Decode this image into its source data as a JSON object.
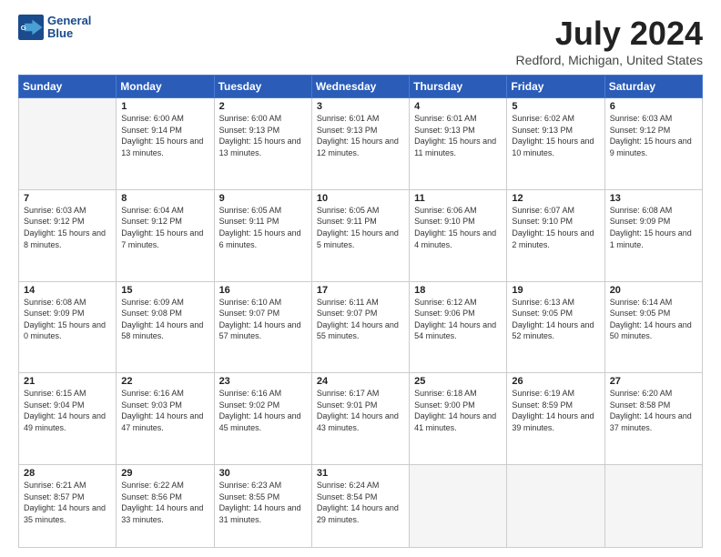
{
  "header": {
    "logo_line1": "General",
    "logo_line2": "Blue",
    "main_title": "July 2024",
    "subtitle": "Redford, Michigan, United States"
  },
  "calendar": {
    "days_of_week": [
      "Sunday",
      "Monday",
      "Tuesday",
      "Wednesday",
      "Thursday",
      "Friday",
      "Saturday"
    ],
    "weeks": [
      [
        {
          "day": "",
          "empty": true
        },
        {
          "day": "1",
          "sunrise": "6:00 AM",
          "sunset": "9:14 PM",
          "daylight": "15 hours and 13 minutes."
        },
        {
          "day": "2",
          "sunrise": "6:00 AM",
          "sunset": "9:13 PM",
          "daylight": "15 hours and 13 minutes."
        },
        {
          "day": "3",
          "sunrise": "6:01 AM",
          "sunset": "9:13 PM",
          "daylight": "15 hours and 12 minutes."
        },
        {
          "day": "4",
          "sunrise": "6:01 AM",
          "sunset": "9:13 PM",
          "daylight": "15 hours and 11 minutes."
        },
        {
          "day": "5",
          "sunrise": "6:02 AM",
          "sunset": "9:13 PM",
          "daylight": "15 hours and 10 minutes."
        },
        {
          "day": "6",
          "sunrise": "6:03 AM",
          "sunset": "9:12 PM",
          "daylight": "15 hours and 9 minutes."
        }
      ],
      [
        {
          "day": "7",
          "sunrise": "6:03 AM",
          "sunset": "9:12 PM",
          "daylight": "15 hours and 8 minutes."
        },
        {
          "day": "8",
          "sunrise": "6:04 AM",
          "sunset": "9:12 PM",
          "daylight": "15 hours and 7 minutes."
        },
        {
          "day": "9",
          "sunrise": "6:05 AM",
          "sunset": "9:11 PM",
          "daylight": "15 hours and 6 minutes."
        },
        {
          "day": "10",
          "sunrise": "6:05 AM",
          "sunset": "9:11 PM",
          "daylight": "15 hours and 5 minutes."
        },
        {
          "day": "11",
          "sunrise": "6:06 AM",
          "sunset": "9:10 PM",
          "daylight": "15 hours and 4 minutes."
        },
        {
          "day": "12",
          "sunrise": "6:07 AM",
          "sunset": "9:10 PM",
          "daylight": "15 hours and 2 minutes."
        },
        {
          "day": "13",
          "sunrise": "6:08 AM",
          "sunset": "9:09 PM",
          "daylight": "15 hours and 1 minute."
        }
      ],
      [
        {
          "day": "14",
          "sunrise": "6:08 AM",
          "sunset": "9:09 PM",
          "daylight": "15 hours and 0 minutes."
        },
        {
          "day": "15",
          "sunrise": "6:09 AM",
          "sunset": "9:08 PM",
          "daylight": "14 hours and 58 minutes."
        },
        {
          "day": "16",
          "sunrise": "6:10 AM",
          "sunset": "9:07 PM",
          "daylight": "14 hours and 57 minutes."
        },
        {
          "day": "17",
          "sunrise": "6:11 AM",
          "sunset": "9:07 PM",
          "daylight": "14 hours and 55 minutes."
        },
        {
          "day": "18",
          "sunrise": "6:12 AM",
          "sunset": "9:06 PM",
          "daylight": "14 hours and 54 minutes."
        },
        {
          "day": "19",
          "sunrise": "6:13 AM",
          "sunset": "9:05 PM",
          "daylight": "14 hours and 52 minutes."
        },
        {
          "day": "20",
          "sunrise": "6:14 AM",
          "sunset": "9:05 PM",
          "daylight": "14 hours and 50 minutes."
        }
      ],
      [
        {
          "day": "21",
          "sunrise": "6:15 AM",
          "sunset": "9:04 PM",
          "daylight": "14 hours and 49 minutes."
        },
        {
          "day": "22",
          "sunrise": "6:16 AM",
          "sunset": "9:03 PM",
          "daylight": "14 hours and 47 minutes."
        },
        {
          "day": "23",
          "sunrise": "6:16 AM",
          "sunset": "9:02 PM",
          "daylight": "14 hours and 45 minutes."
        },
        {
          "day": "24",
          "sunrise": "6:17 AM",
          "sunset": "9:01 PM",
          "daylight": "14 hours and 43 minutes."
        },
        {
          "day": "25",
          "sunrise": "6:18 AM",
          "sunset": "9:00 PM",
          "daylight": "14 hours and 41 minutes."
        },
        {
          "day": "26",
          "sunrise": "6:19 AM",
          "sunset": "8:59 PM",
          "daylight": "14 hours and 39 minutes."
        },
        {
          "day": "27",
          "sunrise": "6:20 AM",
          "sunset": "8:58 PM",
          "daylight": "14 hours and 37 minutes."
        }
      ],
      [
        {
          "day": "28",
          "sunrise": "6:21 AM",
          "sunset": "8:57 PM",
          "daylight": "14 hours and 35 minutes."
        },
        {
          "day": "29",
          "sunrise": "6:22 AM",
          "sunset": "8:56 PM",
          "daylight": "14 hours and 33 minutes."
        },
        {
          "day": "30",
          "sunrise": "6:23 AM",
          "sunset": "8:55 PM",
          "daylight": "14 hours and 31 minutes."
        },
        {
          "day": "31",
          "sunrise": "6:24 AM",
          "sunset": "8:54 PM",
          "daylight": "14 hours and 29 minutes."
        },
        {
          "day": "",
          "empty": true
        },
        {
          "day": "",
          "empty": true
        },
        {
          "day": "",
          "empty": true
        }
      ]
    ]
  }
}
